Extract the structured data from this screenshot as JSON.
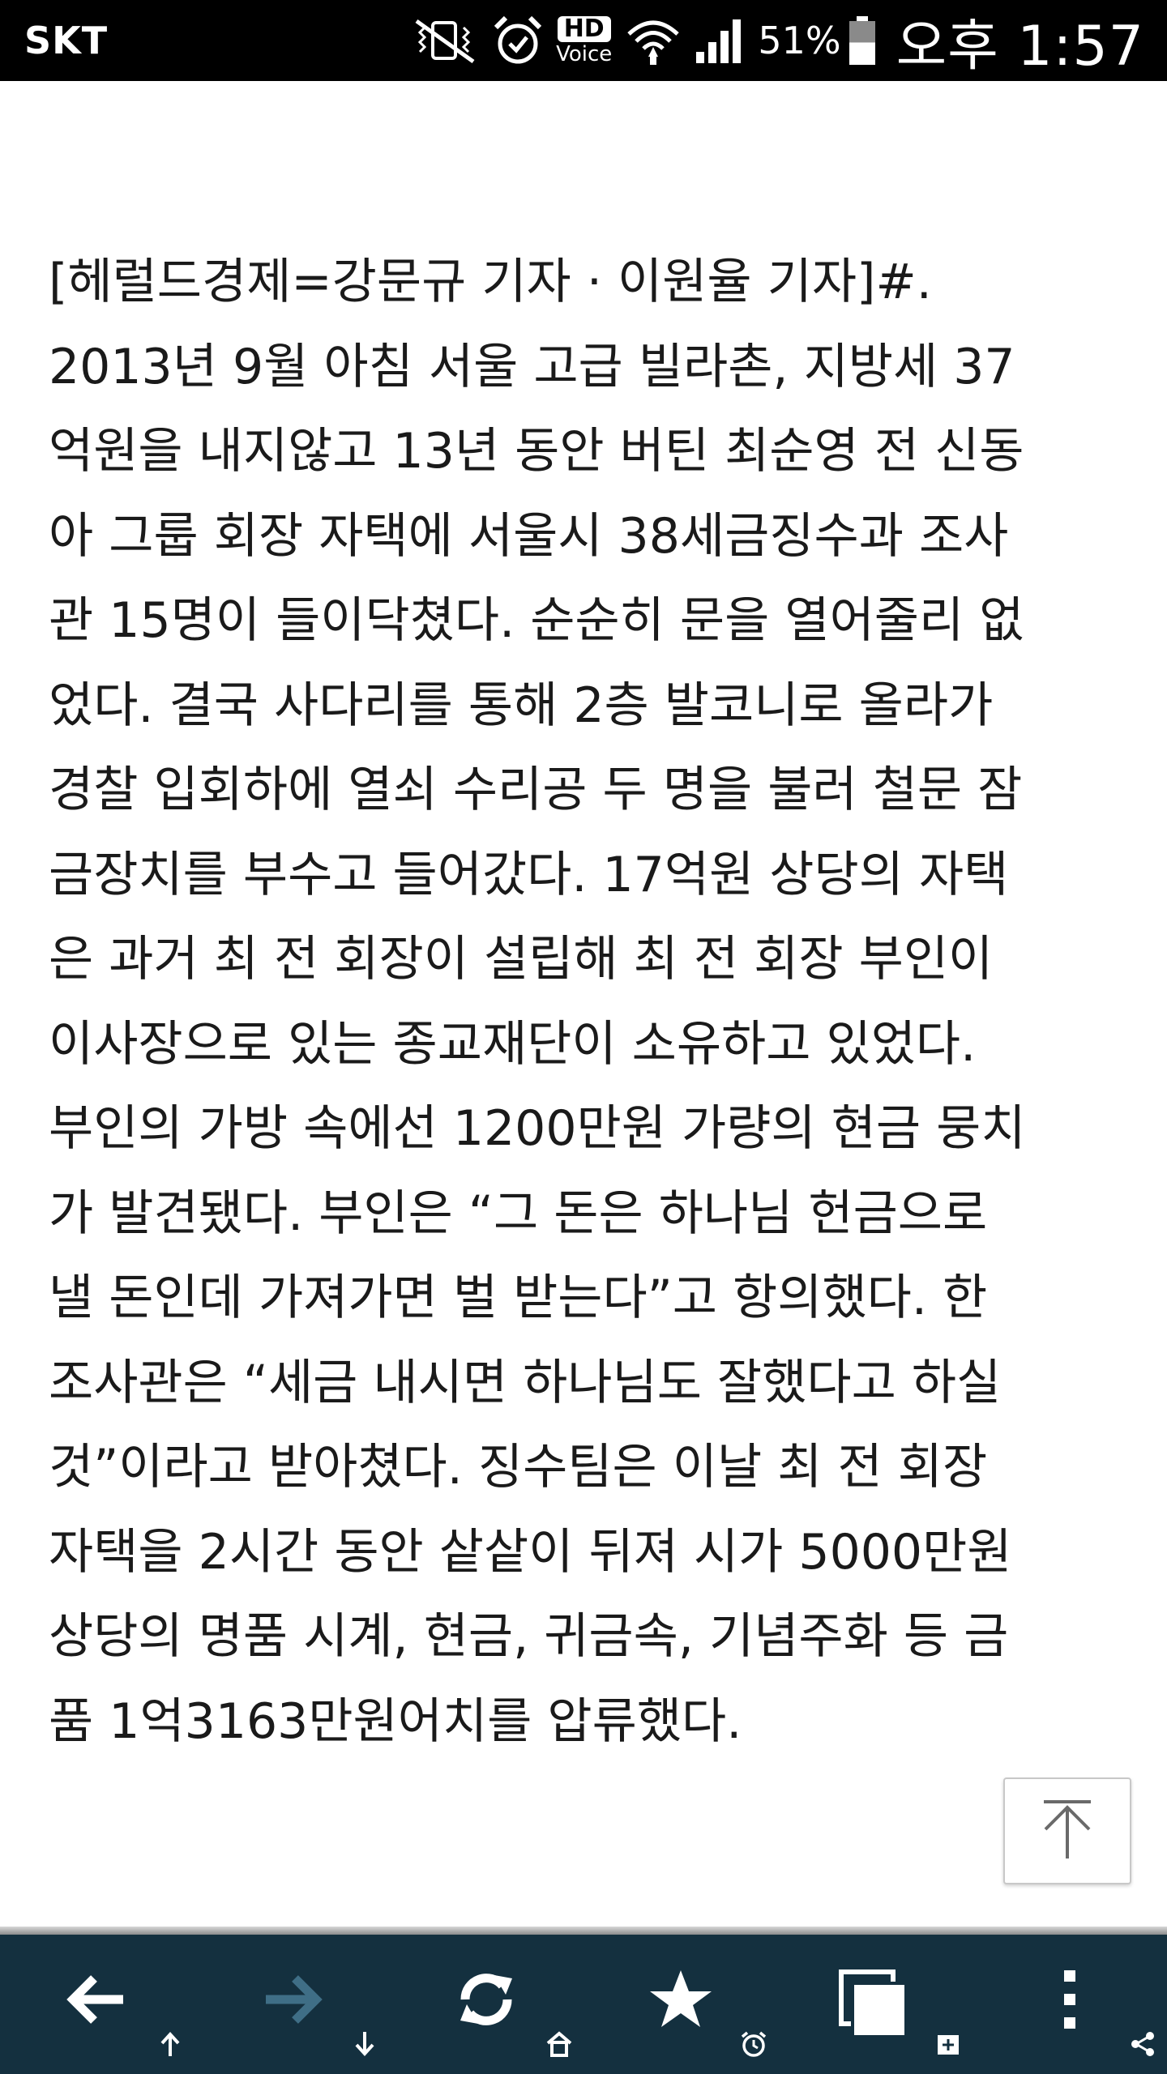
{
  "status_bar": {
    "carrier": "SKT",
    "hd_label": "HD",
    "voice_label": "Voice",
    "battery_percent": "51%",
    "time": "오후 1:57",
    "battery_level": 0.51
  },
  "article": {
    "body": "[헤럴드경제=강문규 기자 · 이원율 기자]#.\n2013년 9월 아침 서울 고급 빌라촌, 지방세 37\n억원을 내지않고 13년 동안 버틴 최순영 전 신동\n아 그룹 회장 자택에 서울시 38세금징수과 조사\n관 15명이 들이닥쳤다. 순순히 문을 열어줄리 없\n었다. 결국 사다리를 통해 2층 발코니로 올라가\n경찰 입회하에 열쇠 수리공 두 명을 불러 철문 잠\n금장치를 부수고 들어갔다. 17억원 상당의 자택\n은 과거 최 전 회장이 설립해 최 전 회장 부인이\n이사장으로 있는 종교재단이 소유하고 있었다.\n부인의 가방 속에선 1200만원 가량의 현금 뭉치\n가 발견됐다. 부인은 “그 돈은 하나님 헌금으로\n낼 돈인데 가져가면 벌 받는다”고 항의했다. 한\n조사관은 “세금 내시면 하나님도 잘했다고 하실\n것”이라고 받아쳤다. 징수팀은 이날 최 전 회장\n자택을 2시간 동안 샅샅이 뒤져 시가 5000만원\n상당의 명품 시계, 현금, 귀금속, 기념주화 등 금\n품 1억3163만원어치를 압류했다."
  },
  "icons": {
    "status": [
      "vibrate-icon",
      "alarm-icon",
      "wifi-icon",
      "signal-icon",
      "battery-icon"
    ],
    "scroll_top": "arrow-up-icon",
    "nav": [
      "back-arrow-icon",
      "forward-arrow-icon",
      "refresh-icon",
      "star-icon",
      "tabs-icon",
      "more-vertical-icon"
    ],
    "nav_sub": [
      "small-up-arrow-icon",
      "small-down-arrow-icon",
      "home-icon",
      "alarm-clock-icon",
      "new-tab-icon",
      "share-icon"
    ]
  },
  "colors": {
    "status_bar_bg": "#000000",
    "nav_bar_bg": "#14303f",
    "nav_icon": "#ffffff",
    "nav_icon_disabled": "#3f6e86",
    "text": "#1a1a1a"
  }
}
